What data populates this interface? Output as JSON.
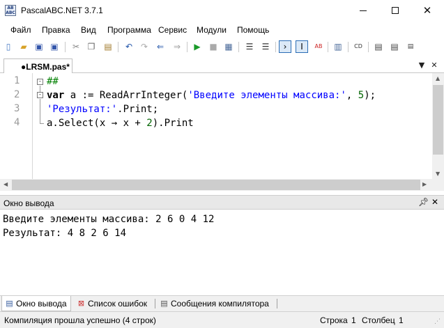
{
  "window": {
    "title": "PascalABC.NET 3.7.1",
    "icon_text": "AB ABC"
  },
  "menu": [
    "Файл",
    "Правка",
    "Вид",
    "Программа",
    "Сервис",
    "Модули",
    "Помощь"
  ],
  "toolbar": {
    "icons": [
      "new-file-icon",
      "open-folder-icon",
      "save-icon",
      "save-all-icon",
      "cut-icon",
      "copy-icon",
      "paste-icon",
      "undo-icon",
      "redo-icon",
      "back-icon",
      "forward-icon",
      "run-icon",
      "stop-icon",
      "debug-icon",
      "step-icon",
      "console-window-icon",
      "text-input-icon",
      "format-icon",
      "compile-icon",
      "code-template-icon",
      "tools-icon",
      "form-designer-icon",
      "project-icon"
    ]
  },
  "editor_tab": {
    "label": "●LRSM.pas*"
  },
  "editor": {
    "line_numbers": [
      "1",
      "2",
      "3",
      "4"
    ],
    "lines": [
      {
        "parts": [
          {
            "t": "##",
            "c": "cm"
          }
        ]
      },
      {
        "parts": [
          {
            "t": "var",
            "c": "kw"
          },
          {
            "t": " a := ReadArrInteger(",
            "c": "pl"
          },
          {
            "t": "'Введите элементы массива:'",
            "c": "str"
          },
          {
            "t": ", ",
            "c": "pl"
          },
          {
            "t": "5",
            "c": "num"
          },
          {
            "t": ");",
            "c": "pl"
          }
        ]
      },
      {
        "parts": [
          {
            "t": "'Результат:'",
            "c": "str"
          },
          {
            "t": ".Print;",
            "c": "pl"
          }
        ]
      },
      {
        "parts": [
          {
            "t": "a.Select(x → x + ",
            "c": "pl"
          },
          {
            "t": "2",
            "c": "num"
          },
          {
            "t": ").Print",
            "c": "pl"
          }
        ]
      }
    ]
  },
  "output_pane": {
    "title": "Окно вывода",
    "lines": [
      "Введите элементы массива: 2 6 0 4 12",
      "Результат: 4 8 2 6 14"
    ]
  },
  "bottom_tabs": [
    {
      "label": "Окно вывода",
      "icon": "output-window-icon",
      "active": true
    },
    {
      "label": "Список ошибок",
      "icon": "error-list-icon",
      "active": false
    },
    {
      "label": "Сообщения компилятора",
      "icon": "compiler-messages-icon",
      "active": false
    }
  ],
  "status": {
    "message": "Компиляция прошла успешно (4 строк)",
    "row_label": "Строка",
    "row_value": "1",
    "col_label": "Столбец",
    "col_value": "1"
  }
}
